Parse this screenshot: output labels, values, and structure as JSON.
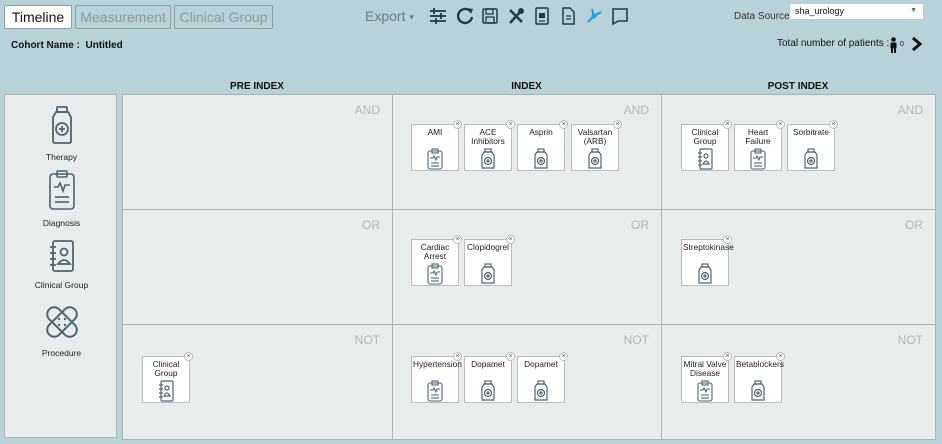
{
  "tabs": [
    {
      "label": "Timeline",
      "active": true
    },
    {
      "label": "Measurement",
      "active": false
    },
    {
      "label": "Clinical Group",
      "active": false
    }
  ],
  "toolbar": {
    "export_label": "Export"
  },
  "data_source": {
    "label": "Data Source",
    "value": "sha_urology"
  },
  "cohort": {
    "label": "Cohort Name :",
    "name": "Untitled"
  },
  "patients": {
    "label": "Total number of patients :",
    "count": "0"
  },
  "columns": {
    "pre": "PRE INDEX",
    "index": "INDEX",
    "post": "POST INDEX"
  },
  "operators": {
    "row1": "AND",
    "row2": "OR",
    "row3": "NOT"
  },
  "palette": [
    {
      "label": "Therapy",
      "icon": "therapy-bottle-icon"
    },
    {
      "label": "Diagnosis",
      "icon": "diagnosis-clipboard-icon"
    },
    {
      "label": "Clinical Group",
      "icon": "clinical-group-book-icon"
    },
    {
      "label": "Procedure",
      "icon": "procedure-bandage-icon"
    }
  ],
  "cells": {
    "index_and": [
      {
        "label": "AMI",
        "type": "diagnosis"
      },
      {
        "label": "ACE Inhibitors",
        "type": "therapy"
      },
      {
        "label": "Asprin",
        "type": "therapy"
      },
      {
        "label": "Valsartan (ARB)",
        "type": "therapy"
      }
    ],
    "post_and": [
      {
        "label": "Clinical Group",
        "type": "group"
      },
      {
        "label": "Heart Failure",
        "type": "diagnosis"
      },
      {
        "label": "Sorbitrate",
        "type": "therapy"
      }
    ],
    "index_or": [
      {
        "label": "Cardiac Arrest",
        "type": "diagnosis"
      },
      {
        "label": "Clopidogrel",
        "type": "therapy"
      }
    ],
    "post_or": [
      {
        "label": "Streptokinase",
        "type": "therapy"
      }
    ],
    "pre_not": [
      {
        "label": "Clinical Group",
        "type": "group"
      }
    ],
    "index_not": [
      {
        "label": "Hypertension",
        "type": "diagnosis"
      },
      {
        "label": "Dopamet",
        "type": "therapy"
      },
      {
        "label": "Dopamet",
        "type": "therapy"
      }
    ],
    "post_not": [
      {
        "label": "Mitral Valve Disease",
        "type": "diagnosis"
      },
      {
        "label": "Betablockers",
        "type": "therapy"
      }
    ]
  },
  "colors": {
    "background": "#b7d3d9",
    "panel": "#e8ecea",
    "icon": "#4a6670"
  }
}
